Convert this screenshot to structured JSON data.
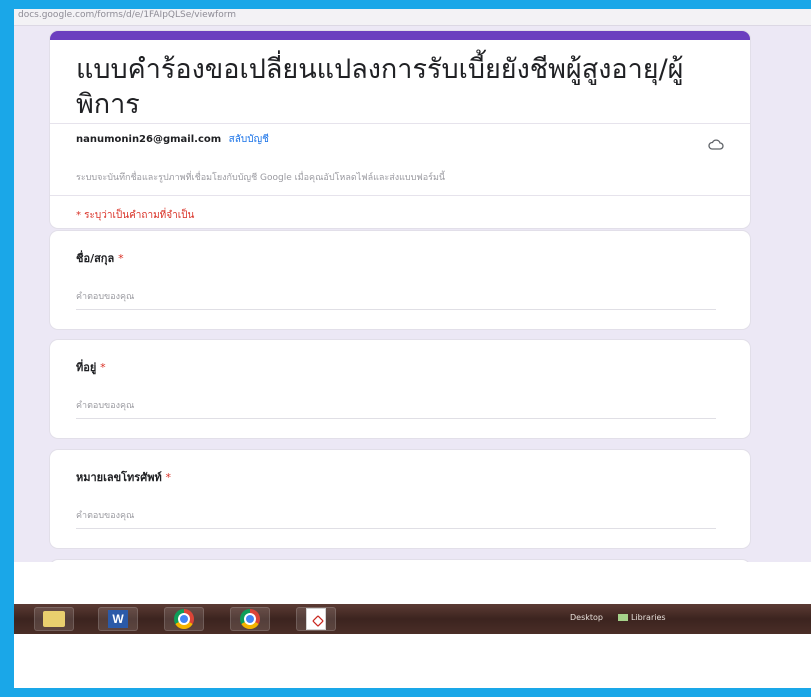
{
  "browser": {
    "url_text": "docs.google.com/forms/d/e/1FAIpQLSe/viewform"
  },
  "form": {
    "title": "แบบคำร้องขอเปลี่ยนแปลงการรับเบี้ยยังชีพผู้สูงอายุ/ผู้พิการ",
    "email": "nanumonin26@gmail.com",
    "switch_account": "สลับบัญชี",
    "save_note": "ระบบจะบันทึกชื่อและรูปภาพที่เชื่อมโยงกับบัญชี Google เมื่อคุณอัปโหลดไฟล์และส่งแบบฟอร์มนี้",
    "required_note": "* ระบุว่าเป็นคำถามที่จำเป็น",
    "answer_placeholder": "คำตอบของคุณ",
    "questions": [
      {
        "label": "ชื่อ/สกุล",
        "required": "*"
      },
      {
        "label": "ที่อยู่",
        "required": "*"
      },
      {
        "label": "หมายเลขโทรศัพท์",
        "required": "*"
      }
    ]
  },
  "taskbar": {
    "desktop_label": "Desktop",
    "libraries_label": "Libraries"
  },
  "colors": {
    "accent": "#6b3fbf",
    "frame": "#1aa7e8",
    "page_bg": "#ece8f5",
    "required": "#d93025",
    "link": "#1a73e8"
  },
  "icons": [
    "cloud-icon",
    "folder-icon",
    "word-icon",
    "chrome-icon",
    "pdf-icon"
  ]
}
